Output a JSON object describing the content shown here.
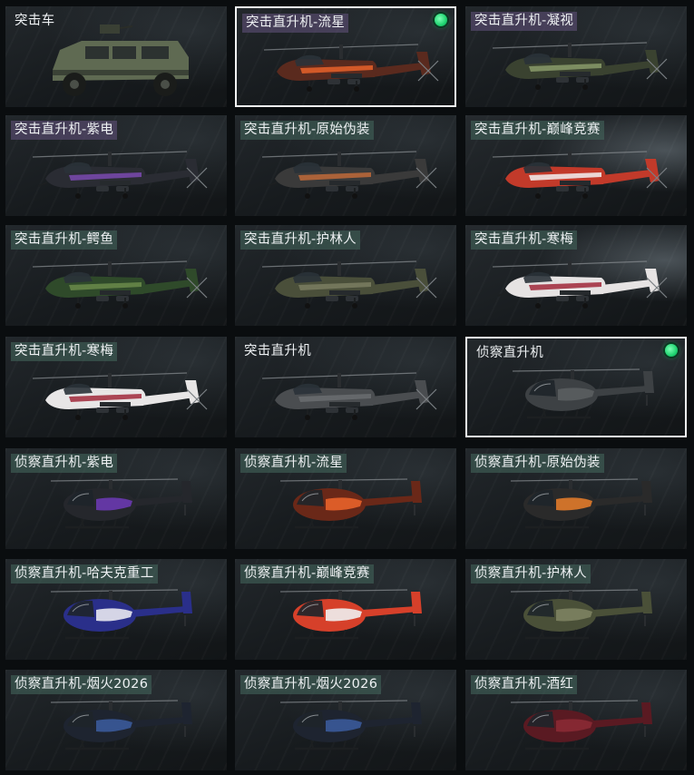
{
  "cards": [
    {
      "label": "突击车",
      "tag": "plain",
      "kind": "truck",
      "equipped": false,
      "selected": false,
      "colors": {
        "body": "#5f6a52",
        "accent": "#3b4236"
      }
    },
    {
      "label": "突击直升机-流星",
      "tag": "purple",
      "kind": "attack",
      "equipped": true,
      "selected": true,
      "colors": {
        "body": "#5a2a1e",
        "accent": "#e8622a"
      }
    },
    {
      "label": "突击直升机-凝视",
      "tag": "purple",
      "kind": "attack",
      "equipped": false,
      "selected": false,
      "colors": {
        "body": "#3a4230",
        "accent": "#8a9a6a"
      }
    },
    {
      "label": "突击直升机-紫电",
      "tag": "purple",
      "kind": "attack",
      "equipped": false,
      "selected": false,
      "colors": {
        "body": "#2a2c33",
        "accent": "#7a4ab0"
      }
    },
    {
      "label": "突击直升机-原始伪装",
      "tag": "green",
      "kind": "attack",
      "equipped": false,
      "selected": false,
      "colors": {
        "body": "#3a3a3a",
        "accent": "#c06a3a"
      }
    },
    {
      "label": "突击直升机-巅峰竞赛",
      "tag": "green",
      "kind": "attack",
      "equipped": false,
      "selected": false,
      "colors": {
        "body": "#c23a2a",
        "accent": "#f2f2f2"
      }
    },
    {
      "label": "突击直升机-鳄鱼",
      "tag": "green",
      "kind": "attack",
      "equipped": false,
      "selected": false,
      "colors": {
        "body": "#2f4a2a",
        "accent": "#6a8a4a"
      }
    },
    {
      "label": "突击直升机-护林人",
      "tag": "green",
      "kind": "attack",
      "equipped": false,
      "selected": false,
      "colors": {
        "body": "#4a4f3a",
        "accent": "#7a7d62"
      }
    },
    {
      "label": "突击直升机-寒梅",
      "tag": "green",
      "kind": "attack",
      "equipped": false,
      "selected": false,
      "colors": {
        "body": "#e6e3e3",
        "accent": "#a0283a"
      }
    },
    {
      "label": "突击直升机-寒梅",
      "tag": "green",
      "kind": "attack",
      "equipped": false,
      "selected": false,
      "colors": {
        "body": "#e8e6e6",
        "accent": "#a0283a"
      }
    },
    {
      "label": "突击直升机",
      "tag": "plain",
      "kind": "attack",
      "equipped": false,
      "selected": false,
      "colors": {
        "body": "#4a4d50",
        "accent": "#6a6d70"
      }
    },
    {
      "label": "侦察直升机",
      "tag": "plain",
      "kind": "scout",
      "equipped": true,
      "selected": true,
      "colors": {
        "body": "#3d4144",
        "accent": "#5a5e61"
      }
    },
    {
      "label": "侦察直升机-紫电",
      "tag": "green",
      "kind": "scout",
      "equipped": false,
      "selected": false,
      "colors": {
        "body": "#25272c",
        "accent": "#6a3ab0"
      }
    },
    {
      "label": "侦察直升机-流星",
      "tag": "green",
      "kind": "scout",
      "equipped": false,
      "selected": false,
      "colors": {
        "body": "#6a2818",
        "accent": "#e8622a"
      }
    },
    {
      "label": "侦察直升机-原始伪装",
      "tag": "green",
      "kind": "scout",
      "equipped": false,
      "selected": false,
      "colors": {
        "body": "#2a2a2a",
        "accent": "#e07a2a"
      }
    },
    {
      "label": "侦察直升机-哈夫克重工",
      "tag": "green",
      "kind": "scout",
      "equipped": false,
      "selected": false,
      "colors": {
        "body": "#2a2f8a",
        "accent": "#e8e8ef"
      }
    },
    {
      "label": "侦察直升机-巅峰竞赛",
      "tag": "green",
      "kind": "scout",
      "equipped": false,
      "selected": false,
      "colors": {
        "body": "#d6402a",
        "accent": "#f0f0f0"
      }
    },
    {
      "label": "侦察直升机-护林人",
      "tag": "green",
      "kind": "scout",
      "equipped": false,
      "selected": false,
      "colors": {
        "body": "#4a5038",
        "accent": "#7d8262"
      }
    },
    {
      "label": "侦察直升机-烟火2026",
      "tag": "green",
      "kind": "scout",
      "equipped": false,
      "selected": false,
      "colors": {
        "body": "#1e2430",
        "accent": "#3a5a9a"
      }
    },
    {
      "label": "侦察直升机-烟火2026",
      "tag": "green",
      "kind": "scout",
      "equipped": false,
      "selected": false,
      "colors": {
        "body": "#1e2430",
        "accent": "#3a5a9a"
      }
    },
    {
      "label": "侦察直升机-酒红",
      "tag": "green",
      "kind": "scout",
      "equipped": false,
      "selected": false,
      "colors": {
        "body": "#5a1a22",
        "accent": "#8a2a34"
      }
    }
  ]
}
